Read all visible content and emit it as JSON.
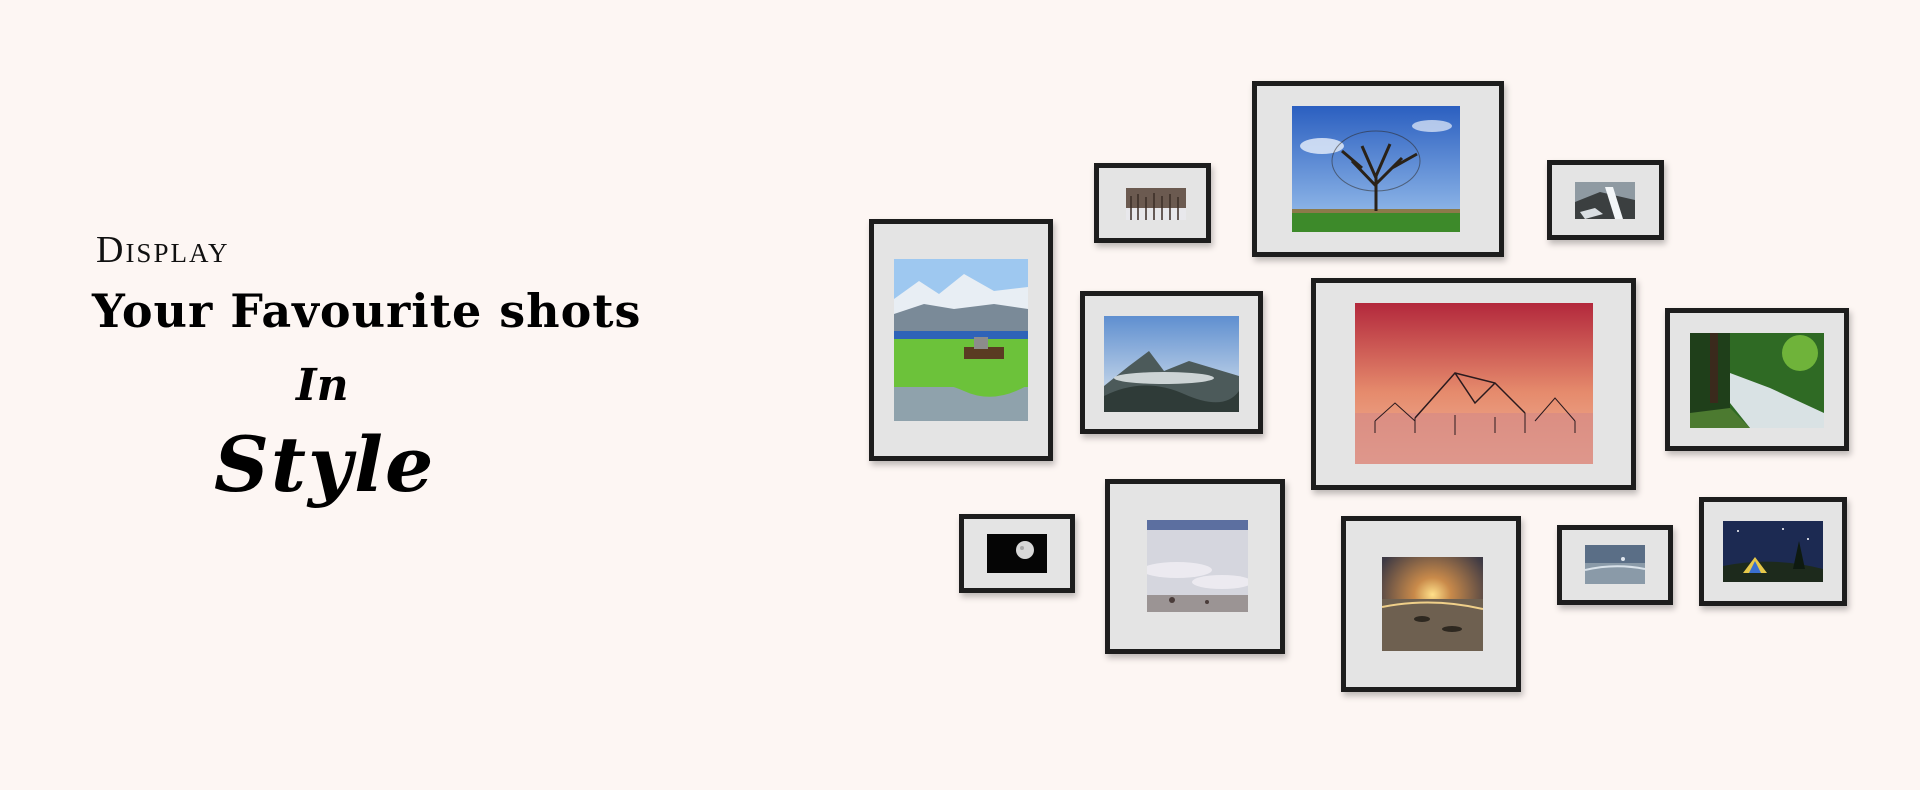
{
  "headline": {
    "line1": "Display",
    "line2": "Your Favourite shots",
    "line3": "In",
    "line4": "Style"
  },
  "colors": {
    "background": "#fdf6f3",
    "frame": "#1d1d1d",
    "mat": "#e4e4e4"
  },
  "photos": [
    "bare-tree-photo",
    "snowy-forest-photo",
    "waterfall-rocks-photo",
    "snowy-mountain-lake-photo",
    "misty-mountains-photo",
    "sunset-fishing-nets-photo",
    "forest-stream-photo",
    "moon-photo",
    "foggy-plain-photo",
    "beach-sunset-photo",
    "shoreline-photo",
    "night-tent-photo"
  ]
}
